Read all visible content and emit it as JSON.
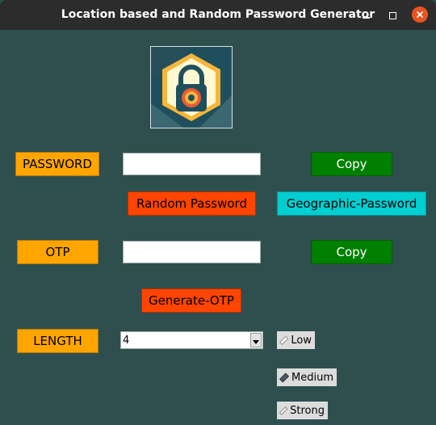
{
  "window": {
    "title": "Location based and Random Password Generator"
  },
  "logo": {
    "icon": "padlock-icon"
  },
  "password": {
    "label": "PASSWORD",
    "value": "",
    "copy_label": "Copy",
    "random_label": "Random Password",
    "geo_label": "Geographic-Password"
  },
  "otp": {
    "label": "OTP",
    "value": "",
    "copy_label": "Copy",
    "generate_label": "Generate-OTP"
  },
  "length": {
    "label": "LENGTH",
    "selected": "4"
  },
  "strength": {
    "options": [
      "Low",
      "Medium",
      "Strong"
    ],
    "selected": "Medium"
  },
  "colors": {
    "background": "#2f4f4f",
    "label_bg": "#ffa500",
    "copy_bg": "#008000",
    "action_bg": "#ff4500",
    "geo_bg": "#00ced1",
    "close_button": "#e95420"
  }
}
